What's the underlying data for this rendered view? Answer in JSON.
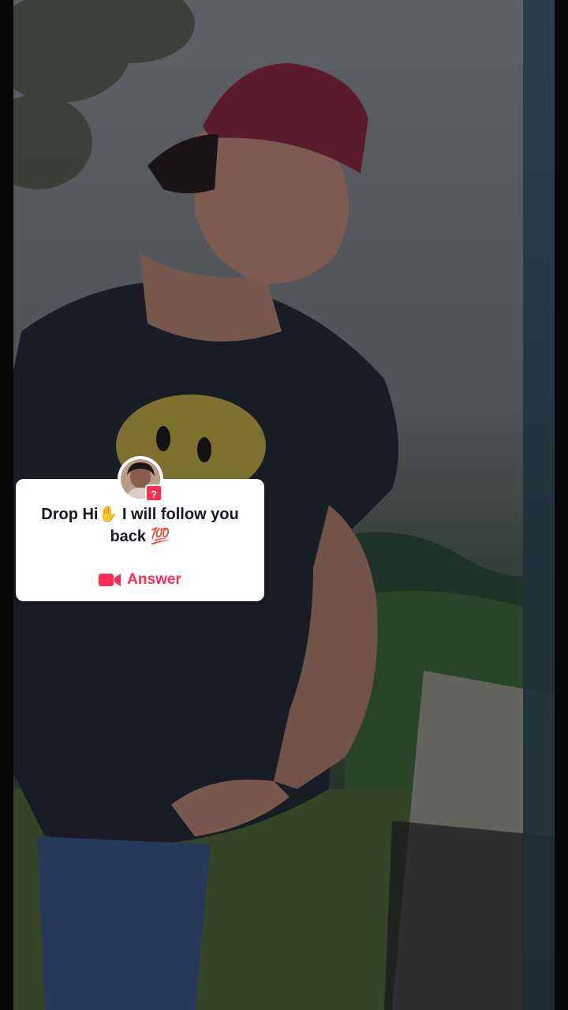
{
  "question": {
    "text": "Drop Hi✋ I will follow you back 💯",
    "badge": "?",
    "answer_label": "Answer"
  },
  "colors": {
    "accent": "#fe2c55",
    "card_bg": "#ffffff",
    "text": "#161823"
  },
  "icons": {
    "answer": "video-camera-icon",
    "badge": "question-badge-icon"
  }
}
